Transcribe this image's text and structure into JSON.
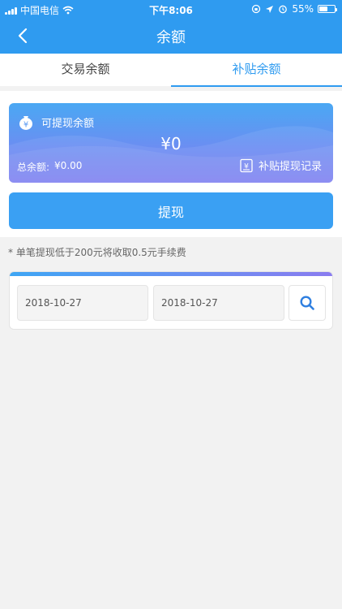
{
  "status_bar": {
    "carrier": "中国电信",
    "time": "下午8:06",
    "battery_percent": "55%",
    "battery_level": 0.55
  },
  "nav": {
    "title": "余额",
    "back_icon": "chevron-left-icon"
  },
  "tabs": [
    {
      "label": "交易余额",
      "active": false
    },
    {
      "label": "补贴余额",
      "active": true
    }
  ],
  "balance_card": {
    "label": "可提现余额",
    "amount": "¥0",
    "total_label": "总余额:",
    "total_value": "¥0.00",
    "record_label": "补贴提现记录",
    "money_icon": "money-bag-icon",
    "record_icon": "record-icon"
  },
  "withdraw_button": "提现",
  "fee_note": "* 单笔提现低于200元将收取0.5元手续费",
  "filter": {
    "start_date": "2018-10-27",
    "end_date": "2018-10-27",
    "search_icon": "search-icon"
  },
  "colors": {
    "primary": "#2f9bf0",
    "button": "#3aa0f3",
    "card_gradient_top": "#4aa8f3",
    "card_gradient_bottom": "#7b7bf0"
  }
}
